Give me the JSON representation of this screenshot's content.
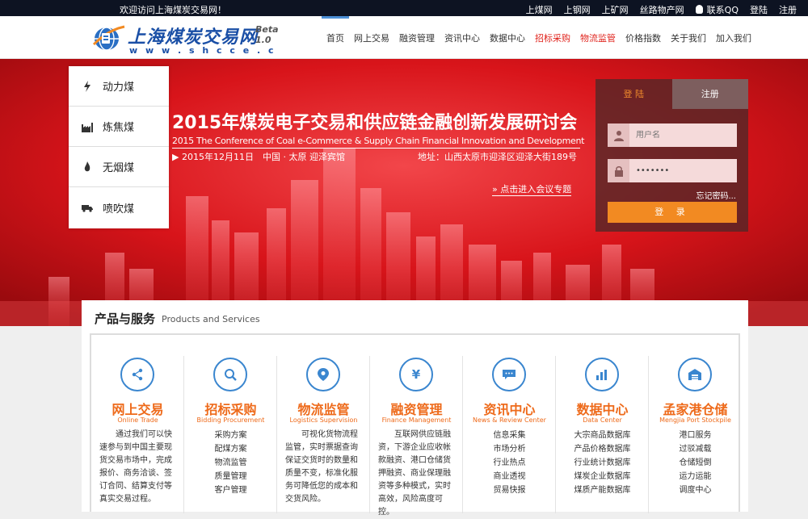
{
  "topbar": {
    "welcome": "欢迎访问上海煤炭交易网！",
    "links": [
      "上煤网",
      "上钢网",
      "上矿网",
      "丝路物产网"
    ],
    "qq": "联系QQ",
    "login": "登陆",
    "register": "注册"
  },
  "header": {
    "logo_name": "上海煤炭交易网",
    "logo_beta": "Beta 1.0",
    "logo_url": "w w w . s h c c e . c o m",
    "nav": [
      {
        "label": "首页",
        "color": "#333333"
      },
      {
        "label": "网上交易",
        "color": "#333333"
      },
      {
        "label": "融资管理",
        "color": "#333333"
      },
      {
        "label": "资讯中心",
        "color": "#333333"
      },
      {
        "label": "数据中心",
        "color": "#333333"
      },
      {
        "label": "招标采购",
        "color": "#e0231c"
      },
      {
        "label": "物流监管",
        "color": "#e0231c"
      },
      {
        "label": "价格指数",
        "color": "#333333"
      },
      {
        "label": "关于我们",
        "color": "#333333"
      },
      {
        "label": "加入我们",
        "color": "#333333"
      }
    ]
  },
  "sidemenu": [
    {
      "label": "动力煤",
      "icon": "lightning-icon"
    },
    {
      "label": "炼焦煤",
      "icon": "factory-icon"
    },
    {
      "label": "无烟煤",
      "icon": "flame-icon"
    },
    {
      "label": "喷吹煤",
      "icon": "truck-icon"
    }
  ],
  "banner": {
    "title": "2015年煤炭电子交易和供应链金融创新发展研讨会",
    "subtitle": "2015 The Conference of Coal e-Commerce & Supply Chain Financial Innovation and Development",
    "date": "2015年12月11日　中国 · 太原  迎泽宾馆",
    "address": "地址：山西太原市迎泽区迎泽大街189号",
    "enter": "点击进入会议专题"
  },
  "login": {
    "tab_login": "登 陆",
    "tab_register": "注册",
    "username_placeholder": "用户名",
    "password_value": "•••••••",
    "forgot": "忘记密码...",
    "submit": "登  录"
  },
  "products": {
    "title": "产品与服务",
    "subtitle": "Products and Services",
    "columns": [
      {
        "name": "网上交易",
        "en": "Online Trade",
        "icon": "share-icon",
        "desc": "通过我们可以快速参与到中国主要现货交易市场中，完成报价、商务洽谈、签订合同、结算支付等真实交易过程。"
      },
      {
        "name": "招标采购",
        "en": "Bidding Procurement",
        "icon": "magnifier-icon",
        "items": [
          "采购方案",
          "配煤方案",
          "物流监管",
          "质量管理",
          "客户管理"
        ]
      },
      {
        "name": "物流监管",
        "en": "Logistics Supervision",
        "icon": "location-pin-icon",
        "desc": "可视化货物流程监管，实时票据查询保证交货时的数量和质量不变，标准化服务可降低您的成本和交货风险。"
      },
      {
        "name": "融资管理",
        "en": "Finance Management",
        "icon": "yen-icon",
        "desc": "互联网供应链融资，下游企业应收帐款融资、港口仓储货押融资、商业保理融资等多种模式，实时高效，风险高度可控。"
      },
      {
        "name": "资讯中心",
        "en": "News & Review Center",
        "icon": "chat-bubble-icon",
        "items": [
          "信息采集",
          "市场分析",
          "行业热点",
          "商业透视",
          "贸易快报"
        ]
      },
      {
        "name": "数据中心",
        "en": "Data Center",
        "icon": "bar-chart-icon",
        "items": [
          "大宗商品数据库",
          "产品价格数据库",
          "行业统计数据库",
          "煤炭企业数据库",
          "煤质产能数据库"
        ]
      },
      {
        "name": "孟家港仓储",
        "en": "Mengjia Port Stockpile",
        "icon": "warehouse-icon",
        "items": [
          "港口服务",
          "过驳减载",
          "仓储短倒",
          "运力运能",
          "调度中心"
        ]
      }
    ]
  },
  "colors": {
    "brand_blue": "#1a4fa6",
    "accent_orange": "#f28a22",
    "product_orange": "#ee6a1a",
    "icon_blue": "#3a86cf",
    "banner_red": "#d8141a"
  }
}
